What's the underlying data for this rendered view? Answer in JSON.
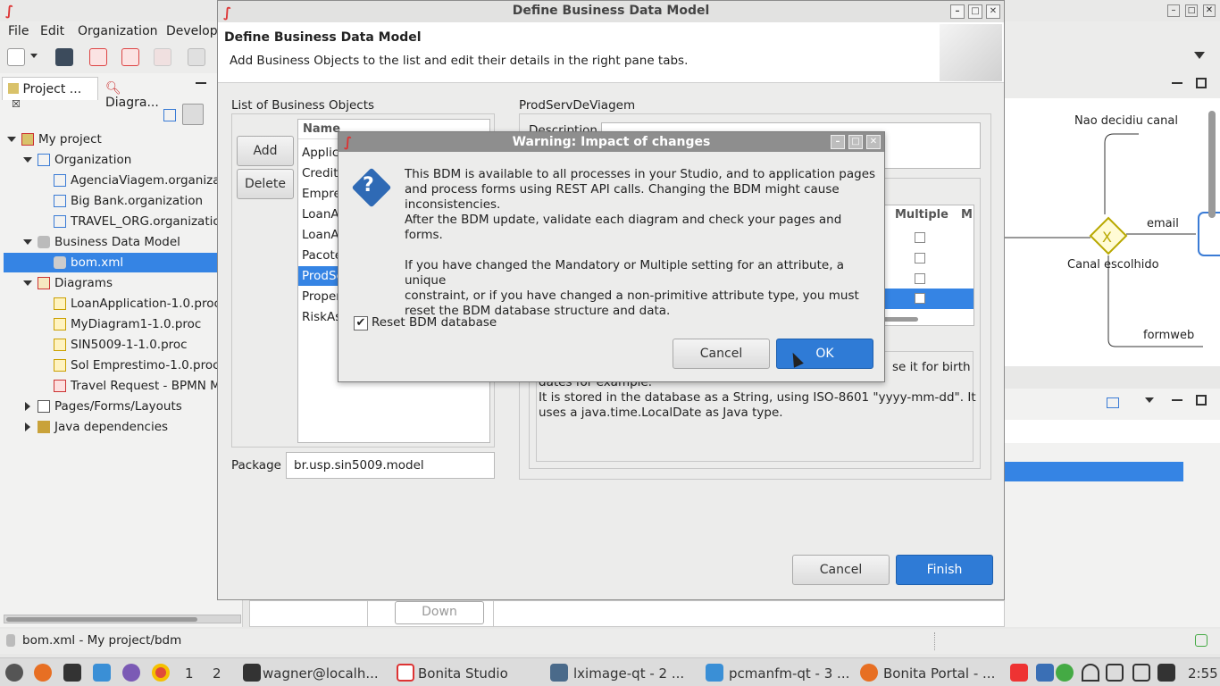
{
  "main": {
    "title": "",
    "menu": [
      "File",
      "Edit",
      "Organization",
      "Develop"
    ],
    "left_tabs": [
      "Project ...",
      "Diagra..."
    ],
    "tree": [
      {
        "label": "My project"
      },
      {
        "label": "Organization"
      },
      {
        "label": "AgenciaViagem.organizat"
      },
      {
        "label": "Big Bank.organization"
      },
      {
        "label": "TRAVEL_ORG.organization"
      },
      {
        "label": "Business Data Model"
      },
      {
        "label": "bom.xml"
      },
      {
        "label": "Diagrams"
      },
      {
        "label": "LoanApplication-1.0.proc"
      },
      {
        "label": "MyDiagram1-1.0.proc"
      },
      {
        "label": "SIN5009-1-1.0.proc"
      },
      {
        "label": "Sol Emprestimo-1.0.proc"
      },
      {
        "label": "Travel Request - BPMN Mo"
      },
      {
        "label": "Pages/Forms/Layouts"
      },
      {
        "label": "Java dependencies"
      }
    ],
    "diagram_labels": [
      "Nao decidiu canal",
      "email",
      "Canal escolhido",
      "formweb"
    ],
    "status_text": "bom.xml - My project/bdm",
    "down_label": "Down"
  },
  "bdm": {
    "window_title": "Define Business Data Model",
    "header_title": "Define Business Data Model",
    "header_subtitle": "Add Business Objects to the list and edit their details in the right pane tabs.",
    "list_label": "List of Business Objects",
    "add": "Add",
    "delete": "Delete",
    "name_col": "Name",
    "objects": [
      "Applic",
      "Credit",
      "Empre",
      "LoanA",
      "LoanA",
      "Pacote",
      "ProdSe",
      "Proper",
      "RiskAs"
    ],
    "package_label": "Package",
    "package_value": "br.usp.sin5009.model",
    "detail_title": "ProdServDeViagem",
    "description_label": "Description",
    "multiple_col": "Multiple",
    "m_col": "M",
    "info_text_1": "se it for birth",
    "info_text_2": "dates for example.",
    "info_text_3": "It is stored in the database as a String, using ISO-8601 \"yyyy-mm-dd\". It",
    "info_text_4": "uses a java.time.LocalDate as Java type.",
    "cancel": "Cancel",
    "finish": "Finish"
  },
  "warning": {
    "title": "Warning: Impact of changes",
    "line1": "This BDM is available to all processes in your Studio, and to application pages",
    "line2": "and process forms using REST API calls. Changing the BDM might cause",
    "line3": "inconsistencies.",
    "line4": "After the BDM update, validate each diagram and check your pages and forms.",
    "line5": "If you have changed the Mandatory or Multiple setting for an attribute, a unique",
    "line6": "constraint, or if you have changed a non-primitive attribute type, you must",
    "line7": "reset the BDM database structure and data.",
    "checkbox_label": "Reset BDM database",
    "checkbox_checked": true,
    "cancel": "Cancel",
    "ok": "OK"
  },
  "taskbar": {
    "desktops": [
      "1",
      "2"
    ],
    "items": [
      "wagner@localh...",
      "Bonita Studio",
      "lximage-qt - 2 ...",
      "pcmanfm-qt - 3 ...",
      "Bonita Portal - ..."
    ],
    "clock": "2:55"
  },
  "colors": {
    "accent": "#2f7bd6",
    "selection": "#3584e4"
  }
}
